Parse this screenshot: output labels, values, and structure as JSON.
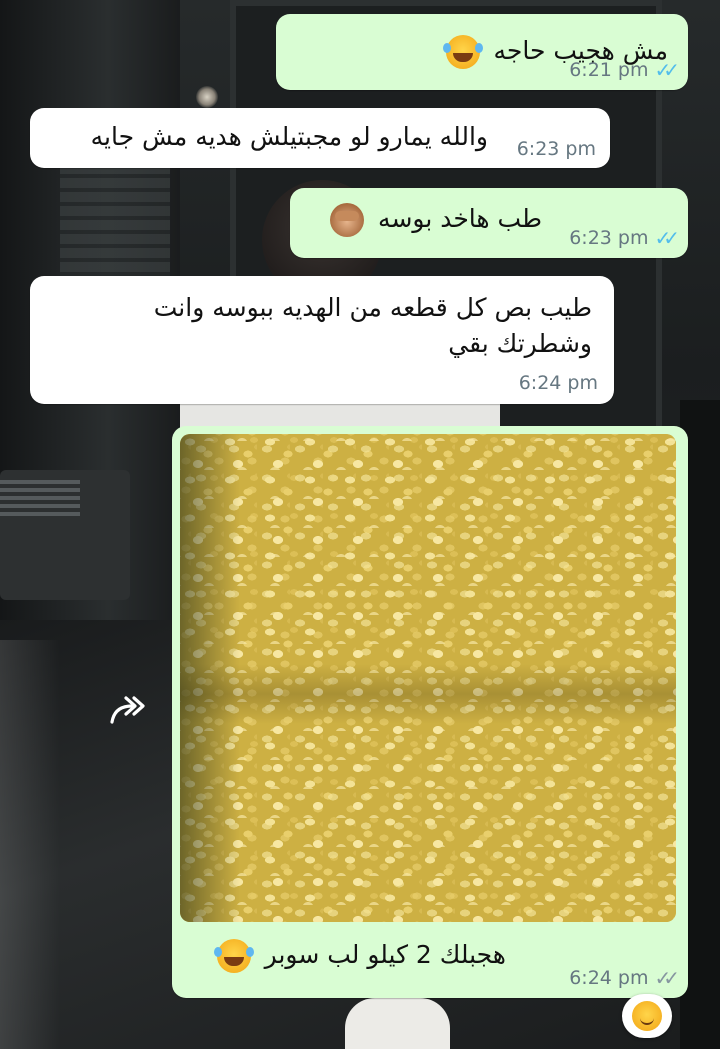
{
  "messages": [
    {
      "id": "m1",
      "direction": "outgoing",
      "text": "مش هجيب حاجه",
      "emoji": "face-with-tears-of-joy",
      "time": "6:21 pm",
      "status": "read"
    },
    {
      "id": "m2",
      "direction": "incoming",
      "text": "والله يمارو لو مجبتيلش هديه مش جايه",
      "time": "6:23 pm"
    },
    {
      "id": "m3",
      "direction": "outgoing",
      "text": "طب هاخد بوسه",
      "emoji": "see-no-evil-monkey",
      "time": "6:23 pm",
      "status": "read"
    },
    {
      "id": "m4",
      "direction": "incoming",
      "lines": [
        "طيب بص كل قطعه من الهديه ببوسه وانت",
        "وشطرتك بقي"
      ],
      "time": "6:24 pm"
    },
    {
      "id": "m5",
      "direction": "outgoing",
      "type": "image",
      "caption": "هجبلك 2 كيلو لب سوبر",
      "emoji": "face-with-tears-of-joy",
      "time": "6:24 pm",
      "status": "delivered",
      "reaction": "slightly-smiling-face"
    }
  ],
  "colors": {
    "outgoing_bubble": "#d9fdd3",
    "incoming_bubble": "#ffffff",
    "read_ticks": "#53bdeb",
    "delivered_ticks": "#8696a0",
    "timestamp": "#667781"
  },
  "icons": {
    "read_ticks": "double-check-icon",
    "forward": "forward-icon"
  }
}
